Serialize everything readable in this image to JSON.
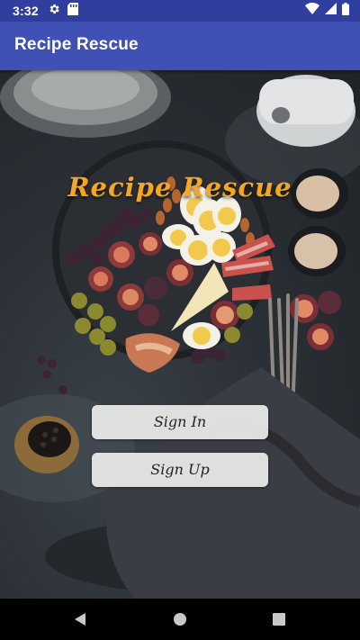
{
  "status_bar": {
    "time": "3:32",
    "icons": [
      "gear-icon",
      "sd-card-icon",
      "wifi-icon",
      "signal-icon",
      "battery-icon"
    ]
  },
  "app_bar": {
    "title": "Recipe Rescue"
  },
  "main": {
    "brand_title": "Recipe Rescue",
    "sign_in_label": "Sign In",
    "sign_up_label": "Sign Up",
    "background_description": "food platter"
  },
  "nav_bar": {
    "buttons": [
      "back-icon",
      "home-icon",
      "recents-icon"
    ]
  },
  "colors": {
    "status_bar": "#303f9f",
    "app_bar": "#3f51b5",
    "brand_text": "#f5a623",
    "button_bg": "#ececec"
  }
}
